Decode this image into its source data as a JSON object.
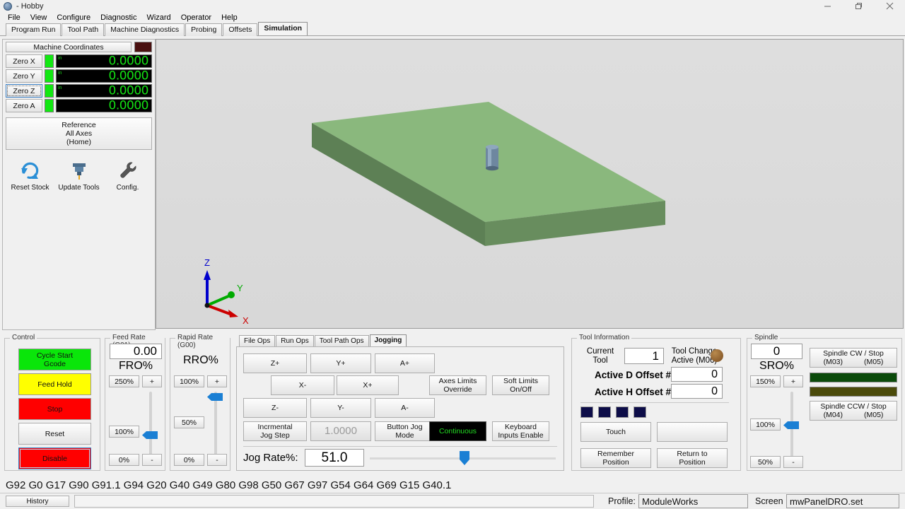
{
  "window": {
    "title": "- Hobby",
    "icon": "app-icon",
    "controls": {
      "minimize": "minimize-icon",
      "restore": "restore-icon",
      "close": "close-icon"
    }
  },
  "menubar": {
    "items": [
      "File",
      "View",
      "Configure",
      "Diagnostic",
      "Wizard",
      "Operator",
      "Help"
    ]
  },
  "main_tabs": {
    "items": [
      "Program Run",
      "Tool Path",
      "Machine Diagnostics",
      "Probing",
      "Offsets",
      "Simulation"
    ],
    "active": "Simulation"
  },
  "dro": {
    "coord_button": "Machine Coordinates",
    "indicator_color": "#4a1010",
    "unit": "in",
    "axes": [
      {
        "zero_label": "Zero X",
        "value": "0.0000",
        "unit": "in",
        "selected": false,
        "led": "#12e812"
      },
      {
        "zero_label": "Zero Y",
        "value": "0.0000",
        "unit": "in",
        "selected": false,
        "led": "#12e812"
      },
      {
        "zero_label": "Zero Z",
        "value": "0.0000",
        "unit": "in",
        "selected": true,
        "led": "#12e812"
      },
      {
        "zero_label": "Zero A",
        "value": "0.0000",
        "unit": "",
        "selected": false,
        "led": "#12e812"
      }
    ],
    "reference_button": [
      "Reference",
      "All Axes",
      "(Home)"
    ],
    "icons": [
      {
        "name": "reset-stock-icon",
        "label": "Reset Stock"
      },
      {
        "name": "update-tools-icon",
        "label": "Update Tools"
      },
      {
        "name": "config-wrench-icon",
        "label": "Config."
      }
    ]
  },
  "viewport": {
    "background": "#dcdcdc",
    "stock": {
      "top_color": "#8ab87d",
      "front_color": "#5d8055",
      "side_color": "#4f7049"
    },
    "tool": {
      "body_color": "#6e87a0",
      "highlight": "#9fb4c6"
    },
    "gizmo": {
      "axes": [
        {
          "label": "Z",
          "color": "#0000cc"
        },
        {
          "label": "Y",
          "color": "#00aa00"
        },
        {
          "label": "X",
          "color": "#cc0000"
        }
      ]
    }
  },
  "control": {
    "legend": "Control",
    "buttons": [
      {
        "label": "Cycle Start\nGcode",
        "line1": "Cycle Start",
        "line2": "Gcode",
        "style": "green"
      },
      {
        "label": "Feed Hold",
        "line1": "Feed Hold",
        "line2": "",
        "style": "yellow"
      },
      {
        "label": "Stop",
        "line1": "Stop",
        "line2": "",
        "style": "red"
      },
      {
        "label": "Reset",
        "line1": "Reset",
        "line2": "",
        "style": "plain"
      },
      {
        "label": "Disable",
        "line1": "Disable",
        "line2": "",
        "style": "red-selected"
      }
    ]
  },
  "feed_rate": {
    "legend": "Feed Rate (G01)",
    "value": "0.00",
    "unit_label": "FRO%",
    "max_label": "250%",
    "mid_label": "100%",
    "min_label": "0%",
    "plus": "+",
    "minus": "-",
    "slider_percent": 40
  },
  "rapid_rate": {
    "legend": "Rapid Rate (G00)",
    "max_label": "100%",
    "unit_label": "RRO%",
    "mid_label": "50%",
    "min_label": "0%",
    "plus": "+",
    "minus": "-",
    "slider_percent": 88
  },
  "jogging": {
    "tabs": [
      "File Ops",
      "Run Ops",
      "Tool Path Ops",
      "Jogging"
    ],
    "active_tab": "Jogging",
    "jog_buttons_row1": [
      "Z+",
      "Y+",
      "A+"
    ],
    "jog_buttons_row2": [
      "X-",
      "X+"
    ],
    "jog_buttons_row3": [
      "Z-",
      "Y-",
      "A-"
    ],
    "limit_buttons": [
      {
        "line1": "Axes Limits",
        "line2": "Override"
      },
      {
        "line1": "Soft Limits",
        "line2": "On/Off"
      }
    ],
    "mode_row": [
      {
        "line1": "Incrmental",
        "line2": "Jog Step",
        "style": "plain"
      },
      {
        "line1": "1.0000",
        "line2": "",
        "style": "dim"
      },
      {
        "line1": "Button Jog",
        "line2": "Mode",
        "style": "plain"
      },
      {
        "line1": "Continuous",
        "line2": "",
        "style": "blackled"
      },
      {
        "line1": "Keyboard",
        "line2": "Inputs Enable",
        "style": "plain"
      }
    ],
    "jog_rate_label": "Jog Rate%:",
    "jog_rate_value": "51.0",
    "jog_rate_percent": 51
  },
  "tool_info": {
    "legend": "Tool Information",
    "current_tool_label_l1": "Current",
    "current_tool_label_l2": "Tool",
    "current_tool_value": "1",
    "tool_change_l1": "Tool Change",
    "tool_change_l2": "Active (M06)",
    "tool_change_led": "#8a5a2b",
    "d_offset_label": "Active D Offset #:",
    "d_offset_value": "0",
    "h_offset_label": "Active H Offset #:",
    "h_offset_value": "0",
    "leds": [
      "#0d0d48",
      "#0d0d48",
      "#0d0d48",
      "#0d0d48"
    ],
    "buttons": [
      {
        "line1": "Touch",
        "line2": ""
      },
      {
        "line1": "",
        "line2": ""
      },
      {
        "line1": "Remember",
        "line2": "Position"
      },
      {
        "line1": "Return to",
        "line2": "Position"
      }
    ]
  },
  "spindle": {
    "legend": "Spindle",
    "value": "0",
    "unit_label": "SRO%",
    "max_label": "150%",
    "mid_label": "100%",
    "min_label": "50%",
    "plus": "+",
    "minus": "-",
    "slider_percent": 45,
    "cw_button_l1": "Spindle CW / Stop",
    "cw_button_m03": "(M03)",
    "cw_button_m05": "(M05)",
    "ccw_button_l1": "Spindle CCW / Stop",
    "ccw_button_m04": "(M04)",
    "ccw_button_m05": "(M05)",
    "bar_cw_color": "#0a4a0a",
    "bar_ccw_color": "#4a4a0a"
  },
  "statusbar": {
    "gcode_line": "G92 G0 G17 G90 G91.1 G94 G20 G40 G49 G80 G98 G50 G67 G97 G54 G64 G69 G15 G40.1",
    "history_button": "History",
    "message": "",
    "profile_label": "Profile:",
    "profile_value": "ModuleWorks",
    "screen_label": "Screen",
    "screen_value": "mwPanelDRO.set"
  }
}
